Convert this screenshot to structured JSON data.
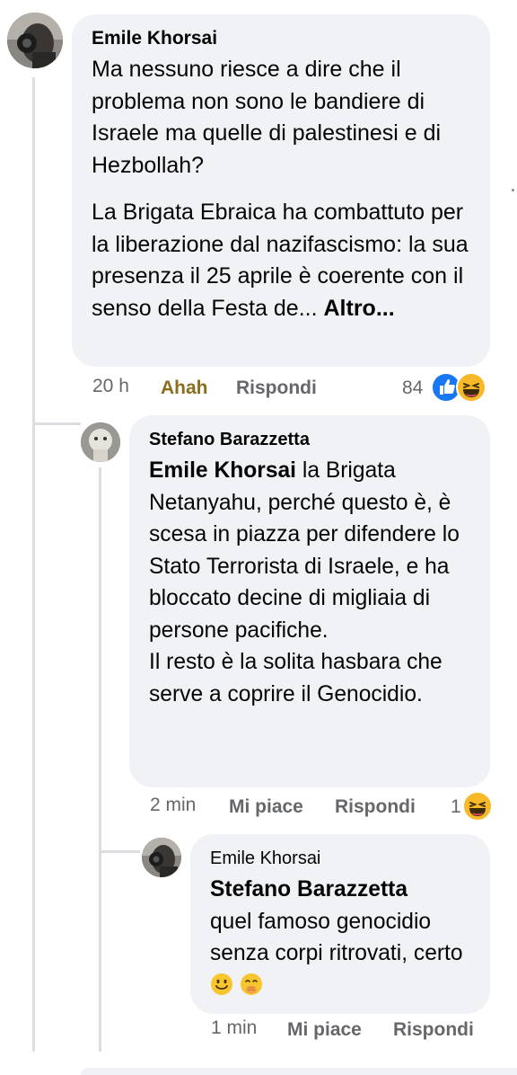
{
  "comments": [
    {
      "author": "Emile Khorsai",
      "paragraphs": [
        "Ma nessuno riesce a dire che il problema non sono le bandiere di Israele ma quelle di palestinesi e di Hezbollah?",
        "La Brigata Ebraica ha combattuto per la liberazione dal nazifascismo: la sua presenza il 25 aprile è coerente con il senso della Festa de..."
      ],
      "more_label": "Altro...",
      "time": "20 h",
      "reaction_label": "Ahah",
      "reply_label": "Rispondi",
      "reaction_count": "84",
      "reaction_icons": [
        "like-icon",
        "laugh-emoji-icon"
      ]
    },
    {
      "author": "Stefano Barazzetta",
      "mention": "Emile Khorsai",
      "text_lines": [
        "la Brigata Netanyahu, perché questo è, è scesa in piazza per difendere lo Stato Terrorista di Israele, e ha bloccato decine di migliaia di persone pacifiche.",
        "Il resto è la solita hasbara che serve a coprire il Genocidio."
      ],
      "time": "2 min",
      "like_label": "Mi piace",
      "reply_label": "Rispondi",
      "reaction_count": "1",
      "reaction_icons": [
        "laugh-emoji-icon"
      ]
    },
    {
      "author": "Emile Khorsai",
      "mention": "Stefano Barazzetta",
      "text": "quel famoso genocidio senza corpi ritrovati, certo",
      "emojis": [
        "smiling-face-emoji",
        "face-hand-over-mouth-emoji"
      ],
      "time": "1 min",
      "like_label": "Mi piace",
      "reply_label": "Rispondi"
    }
  ],
  "colors": {
    "bubble": "#f0f2f5",
    "secondary_text": "#65676b",
    "like_blue": "#1877f2",
    "emoji_yellow": "#f7b928"
  }
}
